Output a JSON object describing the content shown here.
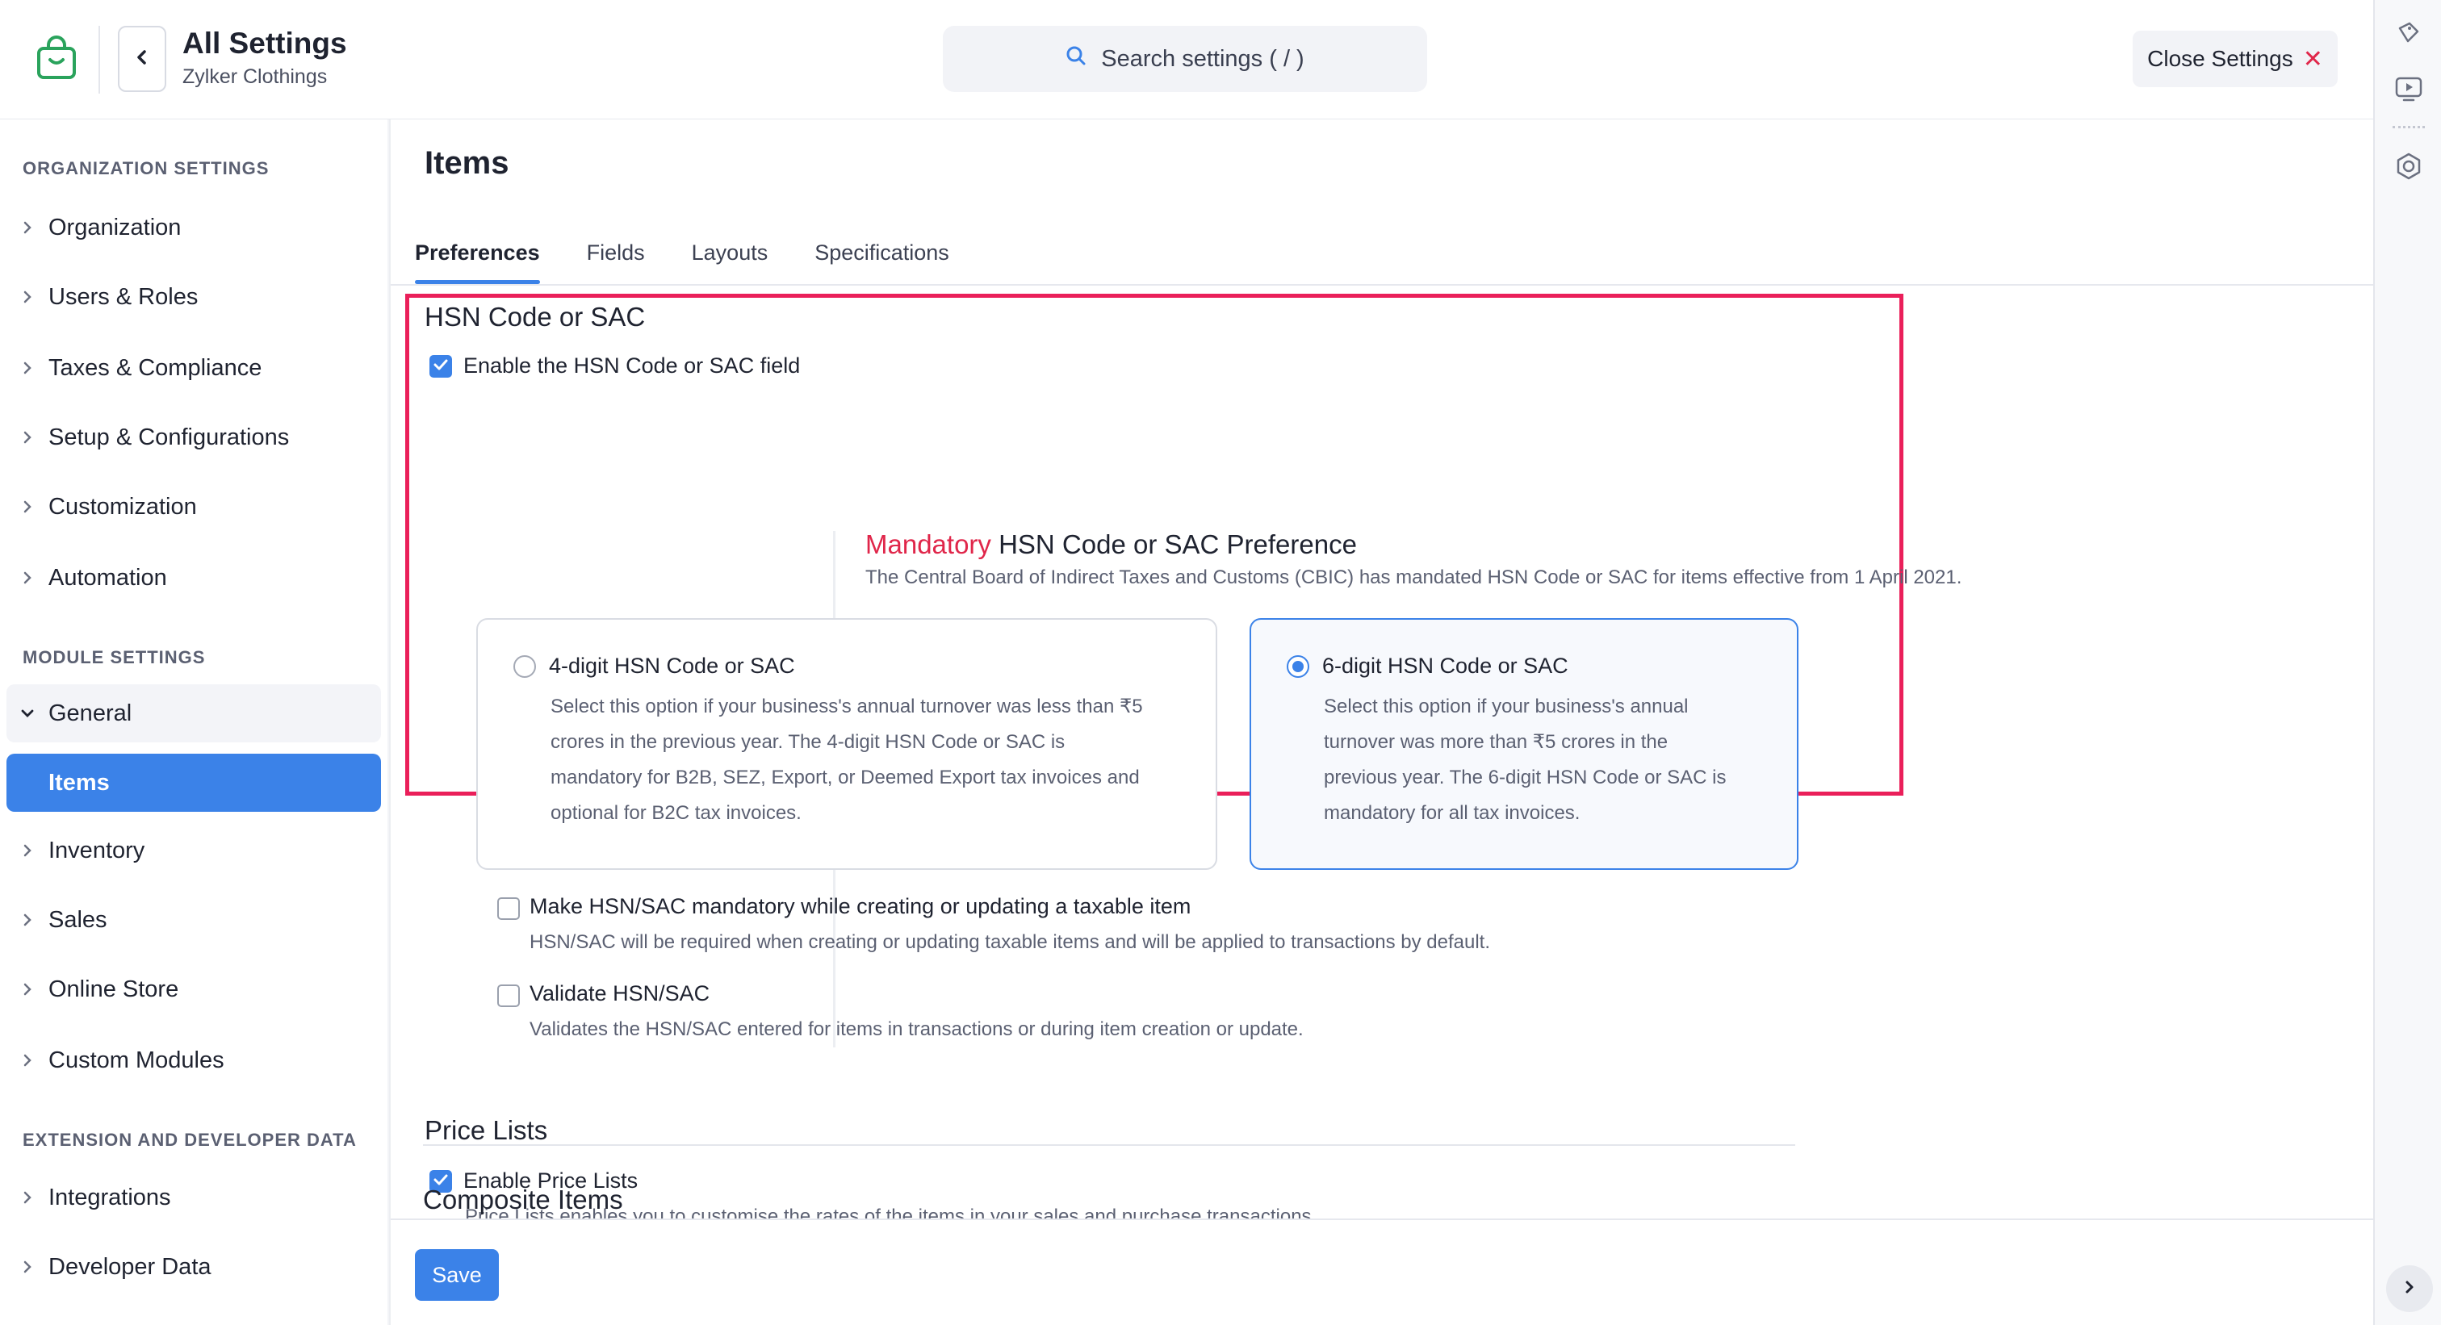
{
  "header": {
    "title": "All Settings",
    "org": "Zylker Clothings",
    "search_placeholder": "Search settings ( / )",
    "close_label": "Close Settings"
  },
  "sidebar": {
    "org_heading": "ORGANIZATION SETTINGS",
    "org_items": [
      {
        "label": "Organization"
      },
      {
        "label": "Users & Roles"
      },
      {
        "label": "Taxes & Compliance"
      },
      {
        "label": "Setup & Configurations"
      },
      {
        "label": "Customization"
      },
      {
        "label": "Automation"
      }
    ],
    "module_heading": "MODULE SETTINGS",
    "general_label": "General",
    "active_label": "Items",
    "module_items": [
      {
        "label": "Inventory"
      },
      {
        "label": "Sales"
      },
      {
        "label": "Online Store"
      },
      {
        "label": "Custom Modules"
      }
    ],
    "ext_heading": "EXTENSION AND DEVELOPER DATA",
    "ext_items": [
      {
        "label": "Integrations"
      },
      {
        "label": "Developer Data"
      }
    ]
  },
  "main": {
    "title": "Items",
    "tabs": [
      {
        "label": "Preferences",
        "active": true
      },
      {
        "label": "Fields"
      },
      {
        "label": "Layouts"
      },
      {
        "label": "Specifications"
      }
    ],
    "hsn": {
      "title": "HSN Code or SAC",
      "enable_label": "Enable the HSN Code or SAC field",
      "enable_checked": true,
      "mandatory_word": "Mandatory",
      "pref_title": " HSN Code or SAC Preference",
      "pref_desc": "The Central Board of Indirect Taxes and Customs (CBIC) has mandated HSN Code or SAC for items effective from 1 April 2021.",
      "options": [
        {
          "title": "4-digit HSN Code or SAC",
          "selected": false,
          "desc_lines": [
            "Select this option if your business's annual turnover was less than ₹5",
            "crores in the previous year. The 4-digit HSN Code or SAC is",
            "mandatory for B2B, SEZ, Export, or Deemed Export tax invoices and",
            "optional for B2C tax invoices."
          ]
        },
        {
          "title": "6-digit HSN Code or SAC",
          "selected": true,
          "desc_lines": [
            "Select this option if your business's annual",
            "turnover was more than ₹5 crores in the",
            "previous year. The 6-digit HSN Code or SAC is",
            "mandatory for all tax invoices."
          ]
        }
      ],
      "mandatory_label": "Make HSN/SAC mandatory while creating or updating a taxable item",
      "mandatory_desc": "HSN/SAC will be required when creating or updating taxable items and will be applied to transactions by default.",
      "validate_label": "Validate HSN/SAC",
      "validate_desc": "Validates the HSN/SAC entered for items in transactions or during item creation or update."
    },
    "price_lists": {
      "title": "Price Lists",
      "enable_label": "Enable Price Lists",
      "enable_checked": true,
      "desc": "Price Lists enables you to customise the rates of the items in your sales and purchase transactions."
    },
    "composite": {
      "title": "Composite Items"
    },
    "save_label": "Save"
  },
  "colors": {
    "accent": "#3b82e8",
    "highlight_border": "#ea1f5a",
    "mandatory_red": "#e0264a",
    "brand_green": "#2aa35c"
  }
}
